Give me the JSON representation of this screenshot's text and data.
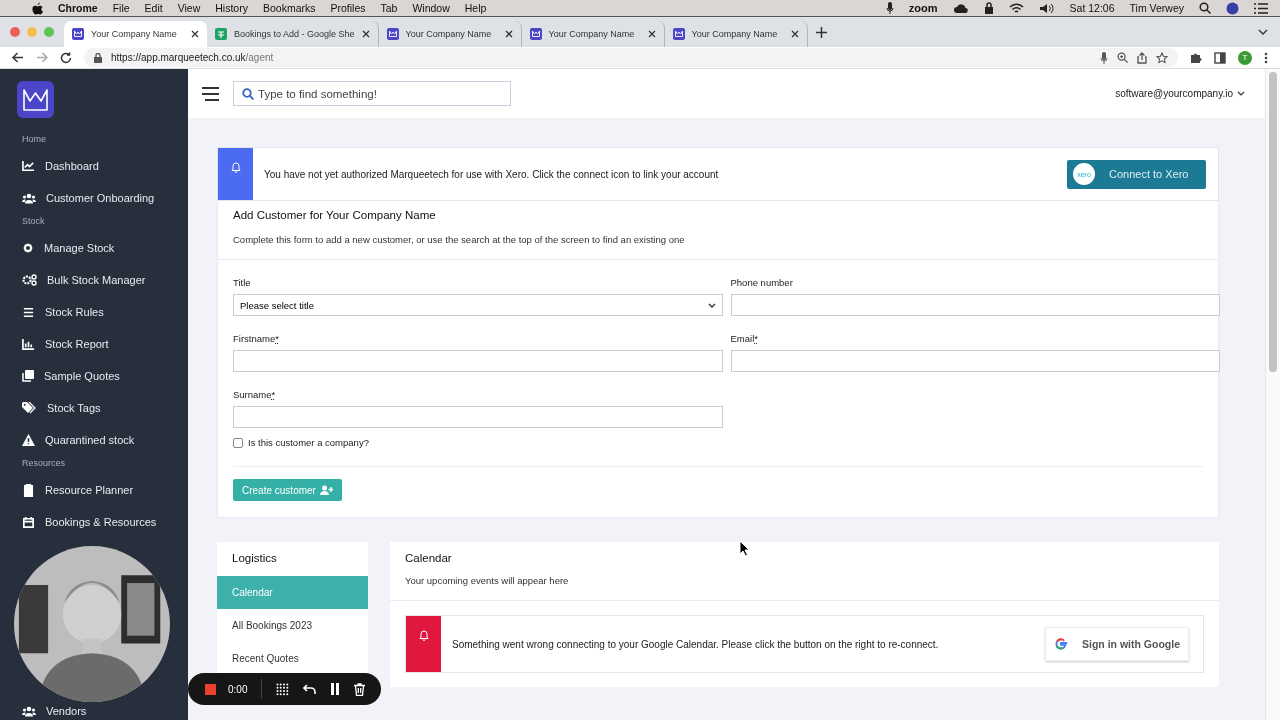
{
  "menu_bar": {
    "app": "Chrome",
    "items": [
      "File",
      "Edit",
      "View",
      "History",
      "Bookmarks",
      "Profiles",
      "Tab",
      "Window",
      "Help"
    ],
    "zoom_label": "zoom",
    "clock": "Sat 12:06",
    "user": "Tim Verwey"
  },
  "tabs": [
    {
      "title": "Your Company Name",
      "kind": "app",
      "selected": true
    },
    {
      "title": "Bookings to Add - Google She",
      "kind": "sheet",
      "selected": false
    },
    {
      "title": "Your Company Name",
      "kind": "app",
      "selected": false
    },
    {
      "title": "Your Company Name",
      "kind": "app",
      "selected": false
    },
    {
      "title": "Your Company Name",
      "kind": "app",
      "selected": false
    }
  ],
  "address_bar": {
    "host": "https://app.marqueetech.co.uk",
    "path": "/agent",
    "profile_initial": "T"
  },
  "sidebar": {
    "sections": [
      {
        "heading": "Home",
        "items": [
          {
            "label": "Dashboard"
          },
          {
            "label": "Customer Onboarding"
          }
        ]
      },
      {
        "heading": "Stock",
        "items": [
          {
            "label": "Manage Stock"
          },
          {
            "label": "Bulk Stock Manager"
          },
          {
            "label": "Stock Rules"
          },
          {
            "label": "Stock Report"
          },
          {
            "label": "Sample Quotes"
          },
          {
            "label": "Stock Tags"
          },
          {
            "label": "Quarantined stock"
          }
        ]
      },
      {
        "heading": "Resources",
        "items": [
          {
            "label": "Resource Planner"
          },
          {
            "label": "Bookings & Resources"
          }
        ]
      }
    ],
    "bottom_items": [
      {
        "label": "Vendors"
      }
    ]
  },
  "header": {
    "search_placeholder": "Type to find something!",
    "account": "software@yourcompany.io"
  },
  "xero_alert": {
    "message": "You have not yet authorized Marqueetech for use with Xero. Click the connect icon to link your account",
    "button": "Connect to Xero",
    "logo_text": "xero"
  },
  "customer_form": {
    "title": "Add Customer for Your Company Name",
    "subtitle": "Complete this form to add a new customer, or use the search at the top of the screen to find an existing one",
    "fields": [
      {
        "label": "Title",
        "kind": "select",
        "value": "Please select title",
        "required": false
      },
      {
        "label": "Phone number",
        "kind": "text",
        "required": false
      },
      {
        "label": "Firstname",
        "kind": "text",
        "required": true
      },
      {
        "label": "Email",
        "kind": "text",
        "required": true
      },
      {
        "label": "Surname",
        "kind": "text",
        "required": true
      }
    ],
    "required_mark": "*",
    "company_checkbox": {
      "label": "Is this customer a company?",
      "checked": false
    },
    "submit": "Create customer"
  },
  "logistics": {
    "title": "Logistics",
    "items": [
      {
        "label": "Calendar",
        "selected": true
      },
      {
        "label": "All Bookings 2023",
        "selected": false
      },
      {
        "label": "Recent Quotes",
        "selected": false
      }
    ]
  },
  "calendar": {
    "title": "Calendar",
    "subtitle": "Your upcoming events will appear here",
    "error": "Something went wrong connecting to your Google Calendar. Please click the button on the right to re-connect.",
    "google_button": "Sign in with Google"
  },
  "recorder": {
    "time": "0:00"
  }
}
